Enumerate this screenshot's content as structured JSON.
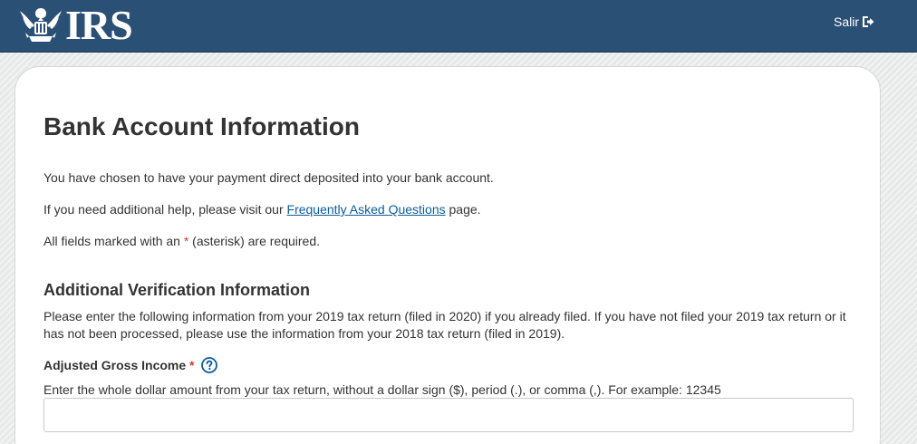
{
  "header": {
    "logo_text": "IRS",
    "logout_label": "Salir"
  },
  "page": {
    "title": "Bank Account Information",
    "intro": "You have chosen to have your payment direct deposited into your bank account.",
    "help_prefix": "If you need additional help, please visit our ",
    "help_link": "Frequently Asked Questions",
    "help_suffix": " page.",
    "required_prefix": "All fields marked with an ",
    "required_star": "*",
    "required_suffix": " (asterisk) are required."
  },
  "verification": {
    "heading": "Additional Verification Information",
    "description": "Please enter the following information from your 2019 tax return (filed in 2020) if you already filed. If you have not filed your 2019 tax return or it has not been processed, please use the information from your 2018 tax return (filed in 2019).",
    "agi_label": "Adjusted Gross Income",
    "agi_required_star": "*",
    "agi_hint": "Enter the whole dollar amount from your tax return, without a dollar sign ($), period (.), or comma (,). For example: 12345",
    "agi_value": "",
    "agi_placeholder": ""
  },
  "icons": {
    "logo": "irs-eagle-icon",
    "logout": "sign-out-icon",
    "help": "question-circle-icon"
  },
  "colors": {
    "header_bg": "#2b5075",
    "link": "#0b5d9c",
    "required": "#d83933",
    "help_icon": "#0b5d9c"
  }
}
